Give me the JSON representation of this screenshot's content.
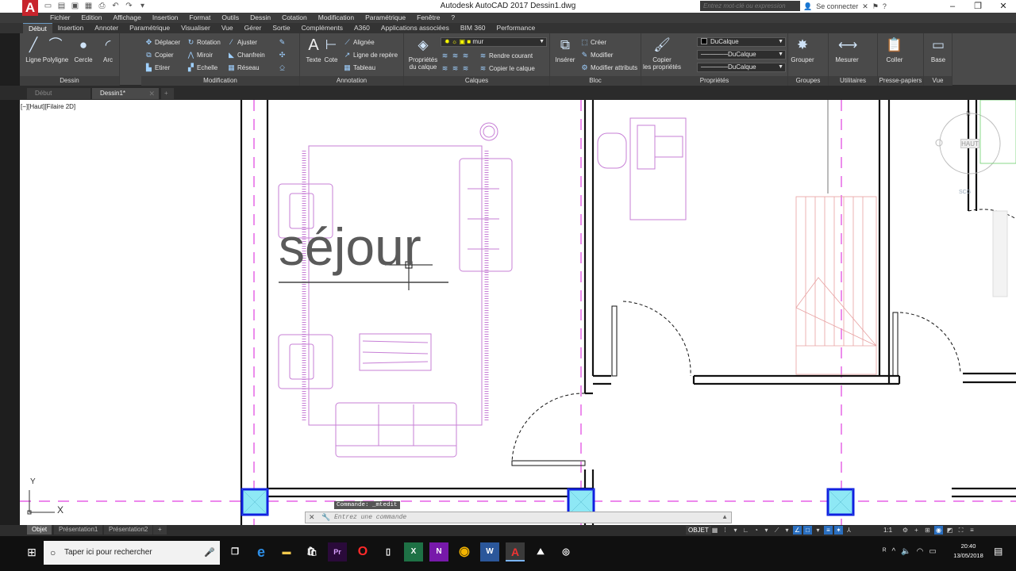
{
  "titlebar": {
    "app_logo": "A",
    "title": "Autodesk AutoCAD 2017   Dessin1.dwg",
    "search_placeholder": "Entrez mot-clé ou expression",
    "sign_in": "Se connecter",
    "qat_icons": [
      "new-icon",
      "open-icon",
      "save-icon",
      "saveas-icon",
      "print-icon",
      "undo-icon",
      "redo-icon",
      "workspace-icon"
    ],
    "win_controls": [
      "minimize",
      "maximize",
      "close"
    ]
  },
  "menubar": {
    "items": [
      "Fichier",
      "Edition",
      "Affichage",
      "Insertion",
      "Format",
      "Outils",
      "Dessin",
      "Cotation",
      "Modification",
      "Paramétrique",
      "Fenêtre",
      "?"
    ]
  },
  "ribbon_tabs": [
    "Début",
    "Insertion",
    "Annoter",
    "Paramétrique",
    "Visualiser",
    "Vue",
    "Gérer",
    "Sortie",
    "Compléments",
    "A360",
    "Applications associées",
    "BIM 360",
    "Performance"
  ],
  "ribbon": {
    "dessin": {
      "title": "Dessin",
      "tools": [
        "Ligne",
        "Polyligne",
        "Cercle",
        "Arc"
      ]
    },
    "modification": {
      "title": "Modification",
      "tools": [
        "Déplacer",
        "Rotation",
        "Ajuster",
        "Copier",
        "Miroir",
        "Chanfrein",
        "Etirer",
        "Echelle",
        "Réseau"
      ]
    },
    "annotation": {
      "title": "Annotation",
      "big_tools": [
        "Texte",
        "Cote"
      ],
      "tools": [
        "Alignée",
        "Ligne de repère",
        "Tableau"
      ]
    },
    "calques": {
      "title": "Calques",
      "big_tool_line1": "Propriétés",
      "big_tool_line2": "du calque",
      "current_layer": "mur",
      "tools": [
        "Rendre courant",
        "Copier le calque"
      ]
    },
    "bloc": {
      "title": "Bloc",
      "big_tool": "Insérer",
      "tools": [
        "Créer",
        "Modifier",
        "Modifier attributs"
      ]
    },
    "proprietes": {
      "title": "Propriétés",
      "big_tool_line1": "Copier",
      "big_tool_line2": "les propriétés",
      "color": "DuCalque",
      "linetype": "DuCalque",
      "lineweight": "DuCalque"
    },
    "groupes": {
      "title": "Groupes",
      "big_tool": "Grouper"
    },
    "utilitaires": {
      "title": "Utilitaires",
      "big_tool": "Mesurer"
    },
    "presse_papiers": {
      "title": "Presse-papiers",
      "big_tool": "Coller"
    },
    "vue": {
      "title": "Vue",
      "big_tool": "Base"
    }
  },
  "doc_tabs": [
    {
      "label": "Début",
      "active": false
    },
    {
      "label": "Dessin1*",
      "active": true
    }
  ],
  "viewport": {
    "label": "[−][Haut][Filaire 2D]",
    "room_label": "séjour",
    "viewcube_face": "HAUT",
    "viewcube_north": "N",
    "viewcube_scu": "SCG",
    "ucs_x": "X",
    "ucs_y": "Y"
  },
  "command": {
    "history": "Commande:  _mtedit",
    "placeholder": "Entrez une commande"
  },
  "layout_tabs": [
    "Objet",
    "Présentation1",
    "Présentation2"
  ],
  "status": {
    "mode": "OBJET",
    "scale": "1:1"
  },
  "taskbar": {
    "search_placeholder": "Taper ici pour rechercher",
    "apps": [
      "task-view",
      "edge",
      "explorer",
      "store",
      "premiere",
      "opera",
      "file",
      "excel",
      "onenote",
      "chrome",
      "word",
      "autocad",
      "photos",
      "media"
    ],
    "time": "20:40",
    "date": "13/05/2018"
  },
  "colors": {
    "accent": "#c8242c",
    "ribbon_bg": "#4a4a4a",
    "furniture": "#c77fd6",
    "stair": "#e8a0a0",
    "axis_dash": "#e040e0",
    "column_fill": "#8ee8f5",
    "column_stroke": "#1020e0"
  }
}
